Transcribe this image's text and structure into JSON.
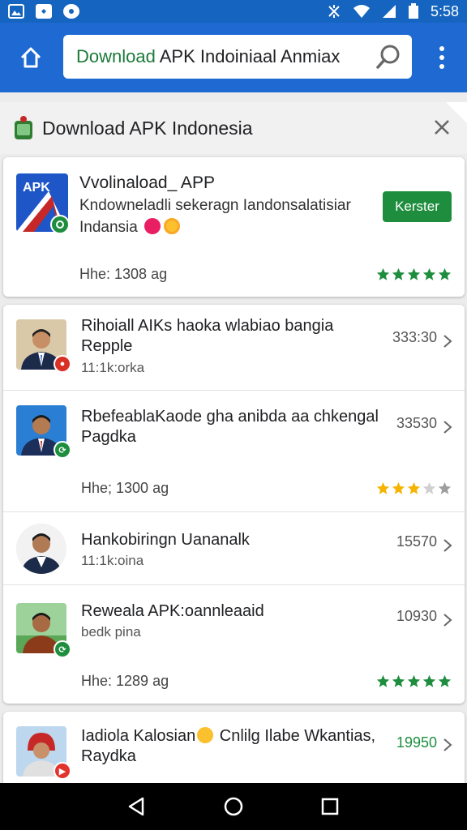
{
  "status_bar": {
    "time": "5:58",
    "icons": [
      "gallery-icon",
      "app-icon",
      "app-icon",
      "vibrate-icon",
      "wifi-icon",
      "signal-icon",
      "battery-icon"
    ]
  },
  "app_bar": {
    "search_prefix": "Download",
    "search_rest": " APK Indoiniaal Anmiax",
    "icons": [
      "home-icon",
      "search-icon",
      "more-vert-icon"
    ]
  },
  "section": {
    "title": "Download APK Indonesia",
    "close_icon": "close-icon"
  },
  "featured": {
    "icon_label": "APK",
    "title": "Vvolinaload_ APP",
    "desc_line1": "Kndowneladli sekeragn Iandonsalatisiar",
    "desc_line2": "Indansia",
    "button": "Kerster",
    "meta": "Hhe:  1308 ag",
    "rating": 5
  },
  "list": [
    {
      "title": "Rihoiall AIKs haoka wlabiao bangia Repple",
      "sub": "11:1k:orka",
      "num": "333:30",
      "badge_color": "#d93025"
    },
    {
      "title": "RbefeablaKaode gha anibda aa chkengal Pagdka",
      "sub": "",
      "num": "33530",
      "meta": "Hhe;  1300 ag",
      "rating": 3,
      "badge_color": "#1e8e3e"
    },
    {
      "title": "Hankobiringn Uananalk",
      "sub": "11:1k:oina",
      "num": "15570",
      "badge_color": ""
    },
    {
      "title": "Reweala APK:oannleaaid",
      "sub": "bedk pina",
      "num": "10930",
      "meta": "Hhe:  1289 ag",
      "rating": 5,
      "badge_color": "#1e8e3e"
    }
  ],
  "last": {
    "title_a": "Iadiola Kalosian",
    "title_b": " Cnlilg Ilabe Wkantias, Raydka",
    "num": "19950",
    "badge_color": "#e2332c"
  },
  "colors": {
    "app_bar": "#1e6ad2",
    "install_green": "#1e8e3e",
    "star_green": "#1e8e3e",
    "star_gold": "#f4b400"
  },
  "nav": [
    "back-icon",
    "home-circle-icon",
    "recents-icon"
  ]
}
